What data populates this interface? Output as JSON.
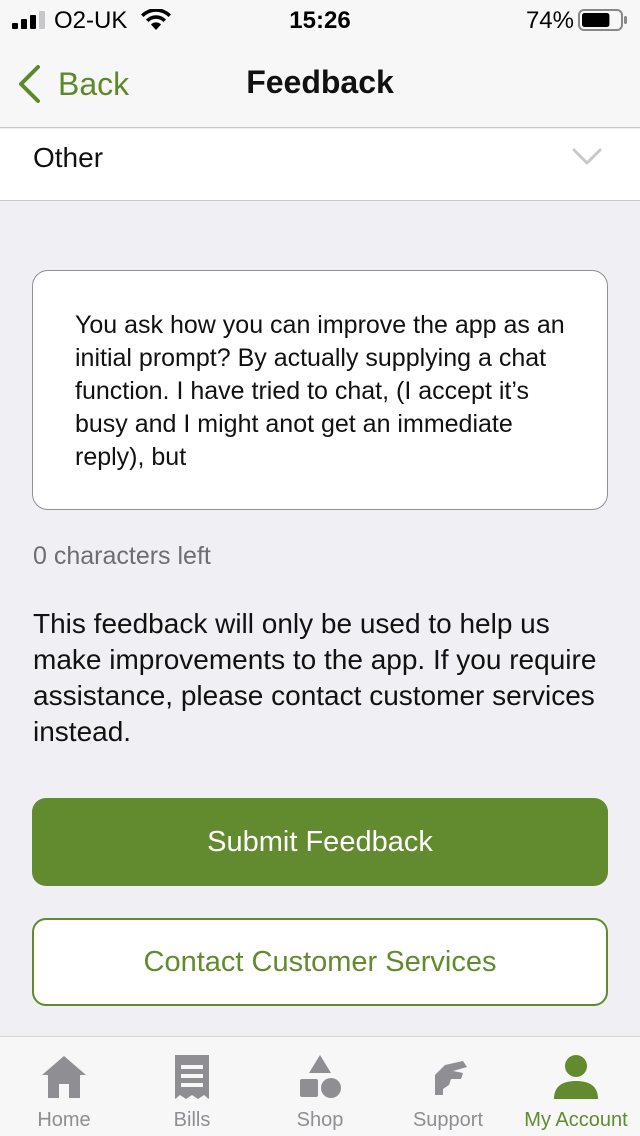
{
  "status_bar": {
    "carrier": "O2-UK",
    "time": "15:26",
    "battery_percent": "74%",
    "battery_level": 0.74,
    "signal_bars": 3
  },
  "nav": {
    "back_label": "Back",
    "title": "Feedback"
  },
  "category": {
    "selected": "Other"
  },
  "feedback": {
    "text": "You ask how you can improve the app as an initial prompt? By actually supplying a chat function. I have tried to chat, (I accept it’s busy and I might anot get an immediate reply), but",
    "chars_left": "0 characters left"
  },
  "notice": "This feedback will only be used to help us make improvements to the app. If you require assistance, please contact customer services instead.",
  "buttons": {
    "submit": "Submit Feedback",
    "contact": "Contact Customer Services"
  },
  "tabs": [
    {
      "label": "Home",
      "icon": "home-icon"
    },
    {
      "label": "Bills",
      "icon": "bills-icon"
    },
    {
      "label": "Shop",
      "icon": "shop-icon"
    },
    {
      "label": "Support",
      "icon": "support-icon"
    },
    {
      "label": "My Account",
      "icon": "account-icon"
    }
  ],
  "active_tab": "My Account",
  "colors": {
    "brand_green": "#628a2e",
    "tab_inactive": "#8e8e93"
  }
}
